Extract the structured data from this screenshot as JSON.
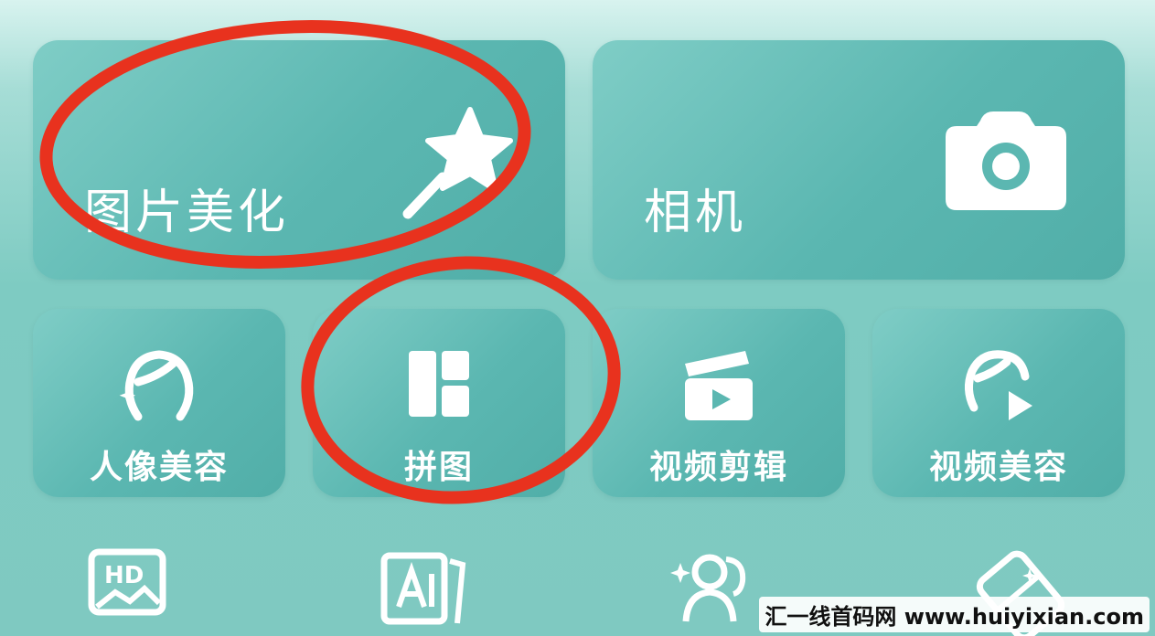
{
  "main_tiles": [
    {
      "label": "图片美化",
      "icon": "magic-wand-icon"
    },
    {
      "label": "相机",
      "icon": "camera-icon"
    }
  ],
  "feature_tiles": [
    {
      "label": "人像美容",
      "icon": "portrait-face-icon"
    },
    {
      "label": "拼图",
      "icon": "collage-layout-icon"
    },
    {
      "label": "视频剪辑",
      "icon": "clapperboard-icon"
    },
    {
      "label": "视频美容",
      "icon": "video-face-icon"
    }
  ],
  "bottom_row_icons": [
    "hd-image-icon",
    "ai-image-icon",
    "people-sparkle-icon",
    "eraser-icon"
  ],
  "watermark": "汇一线首码网 www.huiyixian.com",
  "annotation_color": "#e8321e"
}
